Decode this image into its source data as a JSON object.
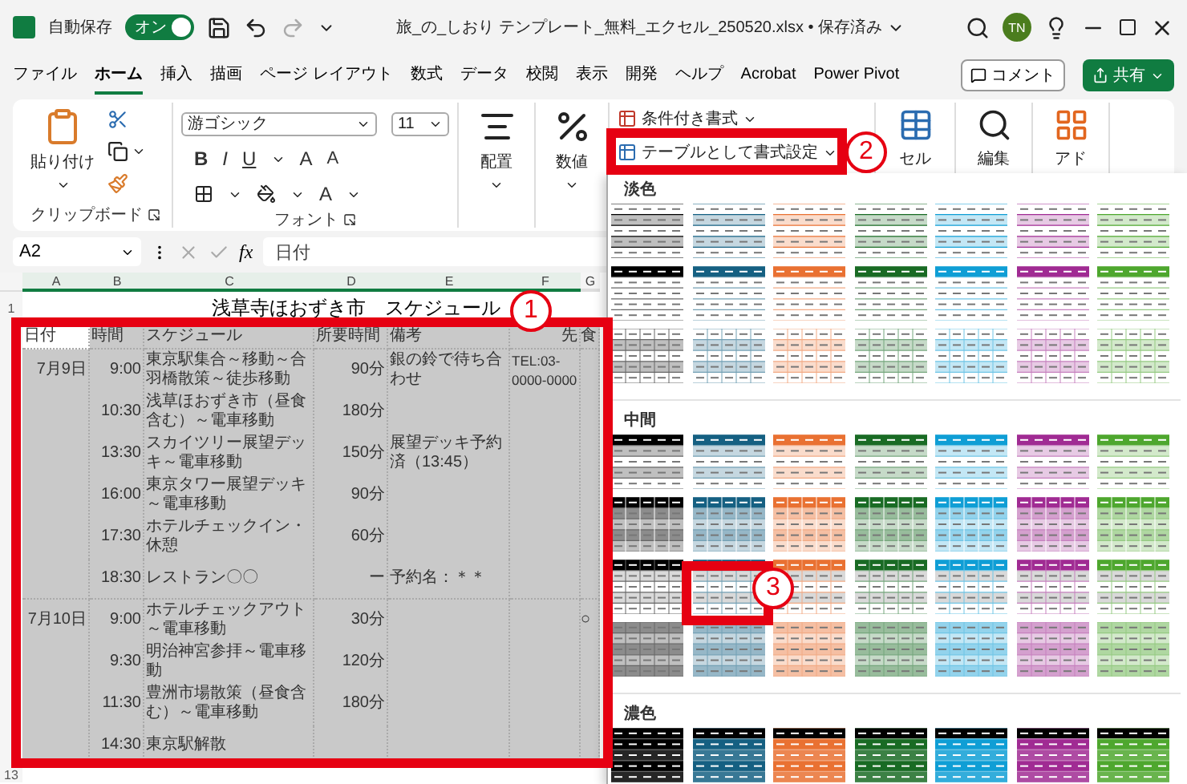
{
  "window": {
    "autosave_label": "自動保存",
    "autosave_toggle": {
      "label": "オン",
      "on": true
    },
    "title": "旅_の_しおり テンプレート_無料_エクセル_250520.xlsx • 保存済み",
    "user_initials": "TN"
  },
  "menu_tabs": [
    {
      "label": "ファイル",
      "selected": false
    },
    {
      "label": "ホーム",
      "selected": true
    },
    {
      "label": "挿入",
      "selected": false
    },
    {
      "label": "描画",
      "selected": false
    },
    {
      "label": "ページ レイアウト",
      "selected": false
    },
    {
      "label": "数式",
      "selected": false
    },
    {
      "label": "データ",
      "selected": false
    },
    {
      "label": "校閲",
      "selected": false
    },
    {
      "label": "表示",
      "selected": false
    },
    {
      "label": "開発",
      "selected": false
    },
    {
      "label": "ヘルプ",
      "selected": false
    },
    {
      "label": "Acrobat",
      "selected": false
    },
    {
      "label": "Power Pivot",
      "selected": false
    }
  ],
  "comment_button": "コメント",
  "share_button": "共有",
  "ribbon": {
    "clipboard": {
      "paste": "貼り付け",
      "group_label": "クリップボード"
    },
    "font": {
      "font_name": "游ゴシック",
      "font_size": "11",
      "bold": "B",
      "italic": "I",
      "underline": "U",
      "grow": "A",
      "shrink": "A",
      "font_color": "A",
      "group_label": "フォント"
    },
    "alignment": "配置",
    "number": "数値",
    "styles": {
      "conditional": "条件付き書式",
      "format_as_table": "テーブルとして書式設定"
    },
    "cells": "セル",
    "editing": "編集",
    "addins": "アド"
  },
  "formula_bar": {
    "name_box": "A2",
    "function_label": "fx",
    "value": "日付"
  },
  "sheet": {
    "columns": [
      {
        "label": "A",
        "selected": true
      },
      {
        "label": "B",
        "selected": true
      },
      {
        "label": "C",
        "selected": true
      },
      {
        "label": "D",
        "selected": true
      },
      {
        "label": "E",
        "selected": true
      },
      {
        "label": "F",
        "selected": true
      },
      {
        "label": "G",
        "selected": false
      }
    ],
    "title_row": {
      "row_number": "1",
      "text": "浅草寺ほおずき市　スケジュール"
    },
    "header": {
      "date": "日付",
      "time": "時間",
      "schedule": "スケジュール",
      "duration": "所要時間",
      "note": "備考",
      "column_f": "先",
      "column_g": "食"
    },
    "rows": [
      {
        "date": "7月9日",
        "time": "9:00",
        "schedule": "東京駅集合～移動～合羽橋散策～徒歩移動",
        "duration": "90分",
        "note": "銀の鈴で待ち合わせ",
        "column_f": "TEL:03-0000-0000"
      },
      {
        "time": "10:30",
        "schedule": "浅草ほおずき市（昼食含む）～電車移動",
        "duration": "180分"
      },
      {
        "time": "13:30",
        "schedule": "スカイツリー展望デッキ～電車移動",
        "duration": "150分",
        "note": "展望デッキ予約済（13:45）"
      },
      {
        "time": "16:00",
        "schedule": "東京タワー展望デッキ～電車移動",
        "duration": "90分"
      },
      {
        "time": "17:30",
        "schedule": "ホテルチェックイン・休憩",
        "duration": "60分"
      },
      {
        "time": "18:30",
        "schedule": "レストラン〇〇",
        "duration": "ー",
        "note": "予約名：＊＊"
      },
      {
        "date": "7月10日",
        "time": "9:00",
        "schedule": "ホテルチェックアウト～電車移動",
        "duration": "30分",
        "column_g": "○"
      },
      {
        "time": "9:30",
        "schedule": "明治神宮参拝～電車移動",
        "duration": "120分"
      },
      {
        "time": "11:30",
        "schedule": "豊洲市場散策（昼食含む）～電車移動",
        "duration": "180分"
      },
      {
        "time": "14:30",
        "schedule": "東京駅解散"
      }
    ],
    "last_row_number": "13"
  },
  "gallery": {
    "styles": [
      {
        "color": "#000000"
      },
      {
        "color": "#156082"
      },
      {
        "color": "#e97132"
      },
      {
        "color": "#196b24"
      },
      {
        "color": "#0f9ed5"
      },
      {
        "color": "#a02b93"
      },
      {
        "color": "#4ea72e"
      }
    ],
    "sections": [
      {
        "label": "淡色",
        "rows": [
          {
            "kind": "lines"
          },
          {
            "kind": "header"
          },
          {
            "kind": "grid"
          }
        ]
      },
      {
        "label": "中間",
        "rows": [
          {
            "kind": "banded"
          },
          {
            "kind": "tinted"
          },
          {
            "kind": "gray"
          },
          {
            "kind": "tintgrid"
          }
        ]
      },
      {
        "label": "濃色",
        "rows": [
          {
            "kind": "dark"
          }
        ]
      }
    ]
  },
  "annotations": [
    {
      "label": "1"
    },
    {
      "label": "2"
    },
    {
      "label": "3"
    }
  ]
}
